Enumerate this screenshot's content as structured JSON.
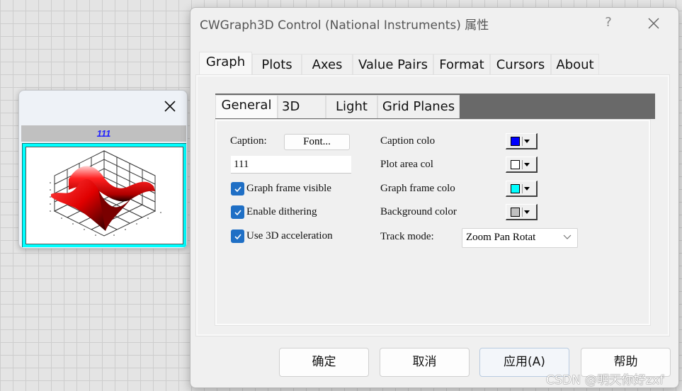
{
  "preview": {
    "caption": "111",
    "caption_color": "#2020ff",
    "frame_color": "#00ffff",
    "background_color": "#c0c0c0",
    "plot_area_color": "#ffffff",
    "close_icon": "close-icon"
  },
  "dialog": {
    "title": "CWGraph3D Control  (National Instruments) 属性",
    "help_label": "?",
    "close_icon": "close-icon",
    "tabs": [
      {
        "label": "Graph",
        "active": true
      },
      {
        "label": "Plots",
        "active": false
      },
      {
        "label": "Axes",
        "active": false
      },
      {
        "label": "Value Pairs",
        "active": false
      },
      {
        "label": "Format",
        "active": false
      },
      {
        "label": "Cursors",
        "active": false
      },
      {
        "label": "About",
        "active": false
      }
    ],
    "subtabs": [
      {
        "label": "General",
        "active": true
      },
      {
        "label": "3D",
        "active": false
      },
      {
        "label": "Light",
        "active": false
      },
      {
        "label": "Grid Planes",
        "active": false
      }
    ],
    "general": {
      "caption_label": "Caption:",
      "font_button": "Font...",
      "caption_value": "111",
      "checkboxes": [
        {
          "label": "Graph frame visible",
          "checked": true
        },
        {
          "label": "Enable dithering",
          "checked": true
        },
        {
          "label": "Use 3D acceleration",
          "checked": true
        }
      ],
      "colors": [
        {
          "label": "Caption colo",
          "value": "#0000ff"
        },
        {
          "label": "Plot area col",
          "value": "#ffffff"
        },
        {
          "label": "Graph frame colo",
          "value": "#00ffff"
        },
        {
          "label": "Background color",
          "value": "#c0c0c0"
        }
      ],
      "track_mode_label": "Track mode:",
      "track_mode_value": "Zoom Pan Rotat"
    },
    "buttons": {
      "ok": "确定",
      "cancel": "取消",
      "apply": "应用(A)",
      "help": "帮助"
    }
  },
  "watermark": "CSDN @明天你好zxf"
}
